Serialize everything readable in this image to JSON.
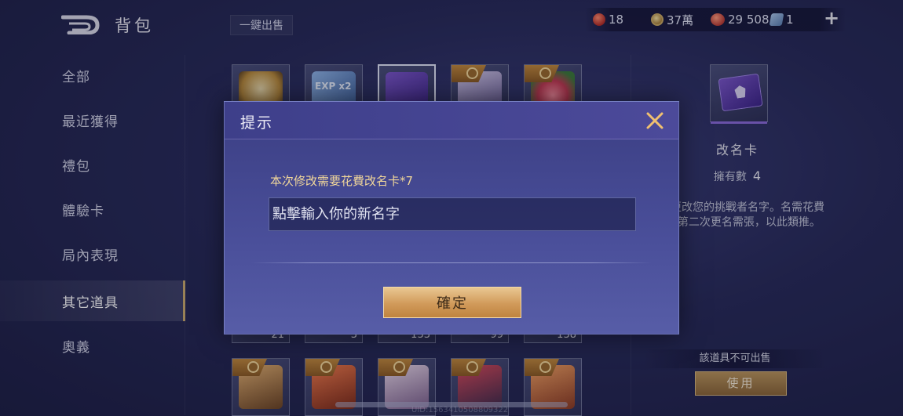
{
  "header": {
    "title": "背包",
    "sell_all_label": "一鍵出售",
    "back_icon": "back-arrow-icon",
    "add_icon": "plus-icon"
  },
  "currencies": [
    {
      "icon": "red-gem-icon",
      "value": "18"
    },
    {
      "icon": "gold-coin-icon",
      "value": "37萬"
    },
    {
      "icon": "red-diamond-icon",
      "value": "29 508"
    },
    {
      "icon": "blue-ticket-icon",
      "value": "1"
    }
  ],
  "sidebar": {
    "items": [
      {
        "label": "全部"
      },
      {
        "label": "最近獲得"
      },
      {
        "label": "禮包"
      },
      {
        "label": "體驗卡"
      },
      {
        "label": "局內表現"
      },
      {
        "label": "其它道具",
        "active": true
      },
      {
        "label": "奧義"
      }
    ]
  },
  "grid": {
    "row1": [
      {
        "icon": "gold-mask-item-icon"
      },
      {
        "icon": "exp-card-icon",
        "text": "EXP x2"
      },
      {
        "icon": "rename-card-icon",
        "selected": true
      },
      {
        "icon": "hero-portrait-icon"
      },
      {
        "icon": "rose-item-icon"
      }
    ],
    "row2_counts": [
      "21",
      "3",
      "133",
      "99",
      "138"
    ],
    "row3": [
      {
        "icon": "hero-portrait-icon"
      },
      {
        "icon": "hero-portrait-icon"
      },
      {
        "icon": "hero-portrait-icon"
      },
      {
        "icon": "hero-portrait-icon"
      },
      {
        "icon": "hero-portrait-icon"
      }
    ]
  },
  "detail": {
    "name": "改名卡",
    "owned_label": "擁有數",
    "owned_count": "4",
    "description": "可以更改您的挑戰者名字。名需花費1張，第二次更名需張，以此類推。",
    "not_sellable": "該道具不可出售",
    "use_label": "使用"
  },
  "footer": {
    "uid": "UID:1563410508809322"
  },
  "dialog": {
    "title": "提示",
    "prompt": "本次修改需要花費改名卡*7",
    "input_placeholder": "點擊輸入你的新名字",
    "confirm_label": "確定",
    "close_icon": "close-icon"
  },
  "colors": {
    "accent_gold": "#c9a96a",
    "dialog_bg": "#4a4f9a",
    "prompt_text": "#f0d69a"
  }
}
